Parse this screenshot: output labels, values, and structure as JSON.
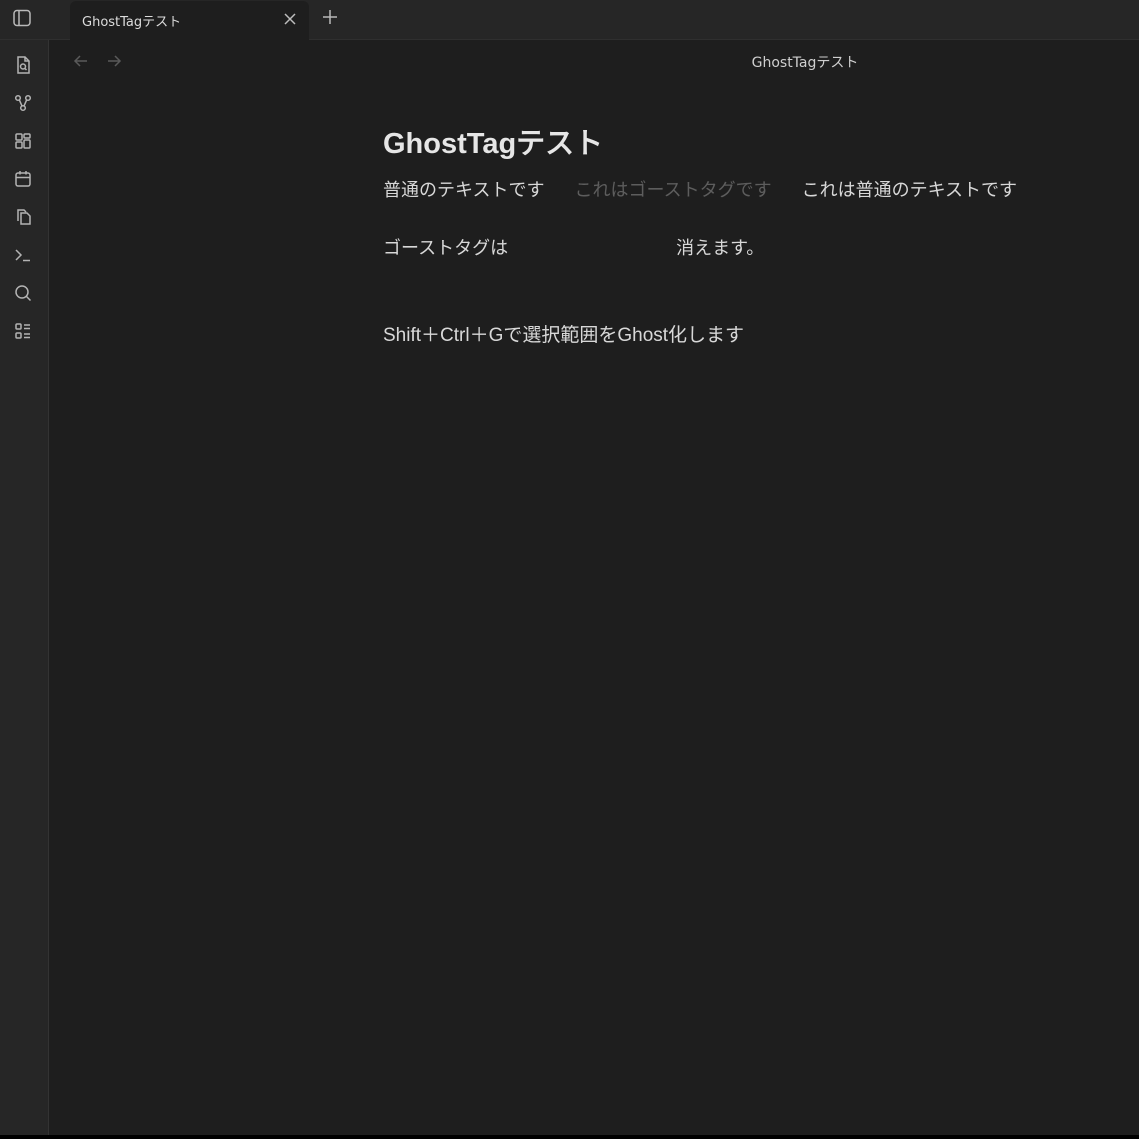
{
  "tabs": [
    {
      "title": "GhostTagテスト"
    }
  ],
  "ribbon_icons": [
    "file-search-icon",
    "graph-icon",
    "layout-grid-icon",
    "calendar-icon",
    "files-icon",
    "terminal-icon",
    "search-icon",
    "list-icon"
  ],
  "view_header": {
    "title": "GhostTagテスト"
  },
  "document": {
    "title": "GhostTagテスト",
    "line1": {
      "normal_a": "普通のテキストです",
      "ghost": "これはゴーストタグです",
      "normal_b": "これは普通のテキストです"
    },
    "line2": {
      "before": "ゴーストタグは",
      "after": "消えます。"
    },
    "line3": "Shift＋Ctrl＋Gで選択範囲をGhost化します"
  }
}
